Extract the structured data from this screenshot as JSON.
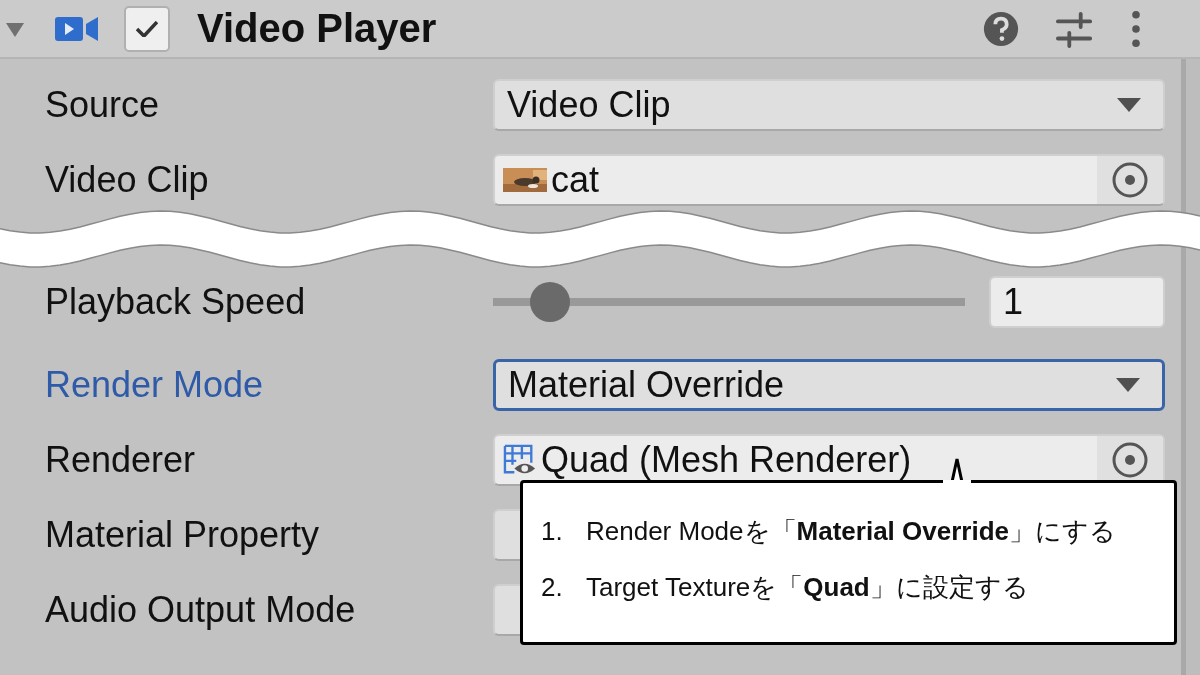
{
  "component": {
    "title": "Video Player",
    "enabled": true,
    "expanded": true
  },
  "rows": [
    {
      "kind": "dropdown",
      "label": "Source",
      "value": "Video Clip",
      "focused": false
    },
    {
      "kind": "clip_field",
      "label": "Video Clip",
      "value": "cat",
      "focused": false
    },
    {
      "kind": "slider",
      "label": "Playback Speed",
      "value": "1",
      "level": 0.12,
      "focused": false
    },
    {
      "kind": "dropdown",
      "label": "Render Mode",
      "value": "Material Override",
      "focused": true
    },
    {
      "kind": "renderer_field",
      "label": "Renderer",
      "value": "Quad (Mesh Renderer)",
      "focused": false
    },
    {
      "kind": "covered",
      "label": "Material Property",
      "focused": false
    },
    {
      "kind": "covered",
      "label": "Audio Output Mode",
      "focused": false
    }
  ],
  "callout": {
    "steps": [
      {
        "number": "1.",
        "text": "Render Modeを「**Material Override**」にする"
      },
      {
        "number": "2.",
        "text": "Target Textureを「**Quad**」に設定する"
      }
    ]
  }
}
